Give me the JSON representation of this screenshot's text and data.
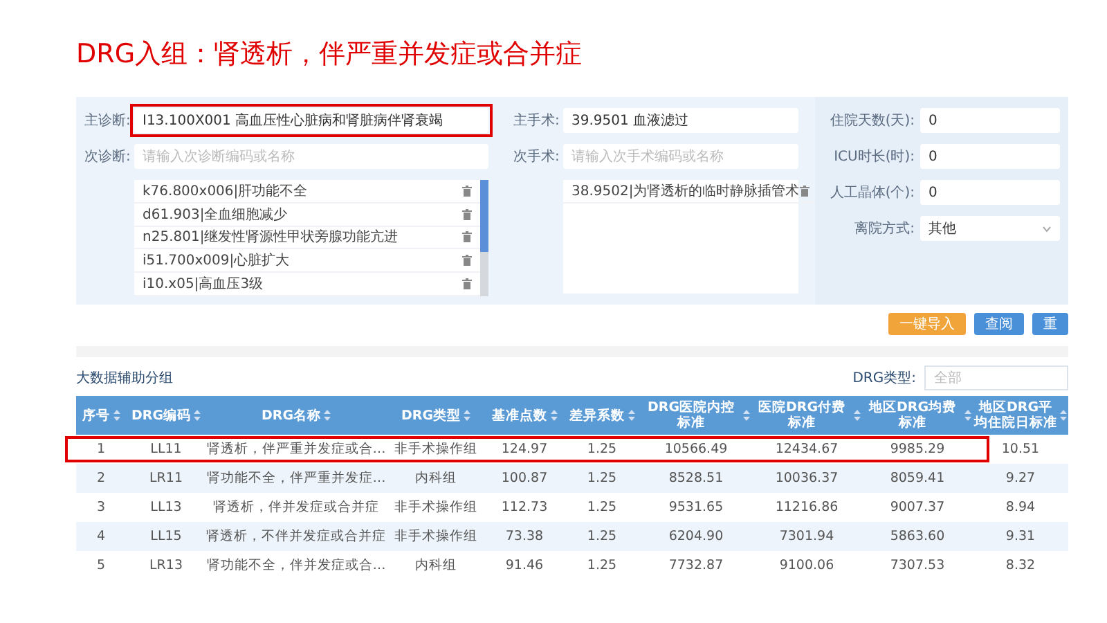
{
  "title": "DRG入组：肾透析，伴严重并发症或合并症",
  "form": {
    "main_diagnosis": {
      "label": "主诊断:",
      "value": "I13.100X001 高血压性心脏病和肾脏病伴肾衰竭",
      "highlighted": true
    },
    "secondary_diagnosis": {
      "label": "次诊断:",
      "placeholder": "请输入次诊断编码或名称"
    },
    "diagnosis_list": [
      "k76.800x006|肝功能不全",
      "d61.903|全血细胞减少",
      "n25.801|继发性肾源性甲状旁腺功能亢进",
      "i51.700x009|心脏扩大",
      "i10.x05|高血压3级"
    ],
    "main_surgery": {
      "label": "主手术:",
      "value": "39.9501 血液滤过"
    },
    "secondary_surgery": {
      "label": "次手术:",
      "placeholder": "请输入次手术编码或名称"
    },
    "surgery_list": [
      "38.9502|为肾透析的临时静脉插管术"
    ],
    "fields": [
      {
        "label": "住院天数(天):",
        "value": "0",
        "kind": "input"
      },
      {
        "label": "ICU时长(时):",
        "value": "0",
        "kind": "input"
      },
      {
        "label": "人工晶体(个):",
        "value": "0",
        "kind": "input"
      },
      {
        "label": "离院方式:",
        "value": "其他",
        "kind": "select"
      }
    ]
  },
  "buttons": [
    {
      "label": "一键导入",
      "kind": "warning"
    },
    {
      "label": "查阅",
      "kind": "primary"
    },
    {
      "label": "重",
      "kind": "primary"
    }
  ],
  "results": {
    "title": "大数据辅助分组",
    "filter": {
      "label": "DRG类型:",
      "placeholder": "全部"
    },
    "columns": [
      "序号",
      "DRG编码",
      "DRG名称",
      "DRG类型",
      "基准点数",
      "差异系数",
      "DRG医院内控标准",
      "医院DRG付费标准",
      "地区DRG均费标准",
      "地区DRG平均住院日标准"
    ],
    "rows": [
      {
        "cells": [
          "1",
          "LL11",
          "肾透析，伴严重并发症或合…",
          "非手术操作组",
          "124.97",
          "1.25",
          "10566.49",
          "12434.67",
          "9985.29",
          "10.51"
        ],
        "highlighted": true
      },
      {
        "cells": [
          "2",
          "LR11",
          "肾功能不全，伴严重并发症…",
          "内科组",
          "100.87",
          "1.25",
          "8528.51",
          "10036.37",
          "8059.41",
          "9.27"
        ],
        "highlighted": false
      },
      {
        "cells": [
          "3",
          "LL13",
          "肾透析，伴并发症或合并症",
          "非手术操作组",
          "112.73",
          "1.25",
          "9531.65",
          "11216.86",
          "9007.37",
          "8.94"
        ],
        "highlighted": false
      },
      {
        "cells": [
          "4",
          "LL15",
          "肾透析，不伴并发症或合并症",
          "非手术操作组",
          "73.38",
          "1.25",
          "6204.90",
          "7301.94",
          "5863.60",
          "9.31"
        ],
        "highlighted": false
      },
      {
        "cells": [
          "5",
          "LR13",
          "肾功能不全，伴并发症或合…",
          "内科组",
          "91.46",
          "1.25",
          "7732.87",
          "9100.06",
          "7307.53",
          "8.32"
        ],
        "highlighted": false
      }
    ]
  }
}
